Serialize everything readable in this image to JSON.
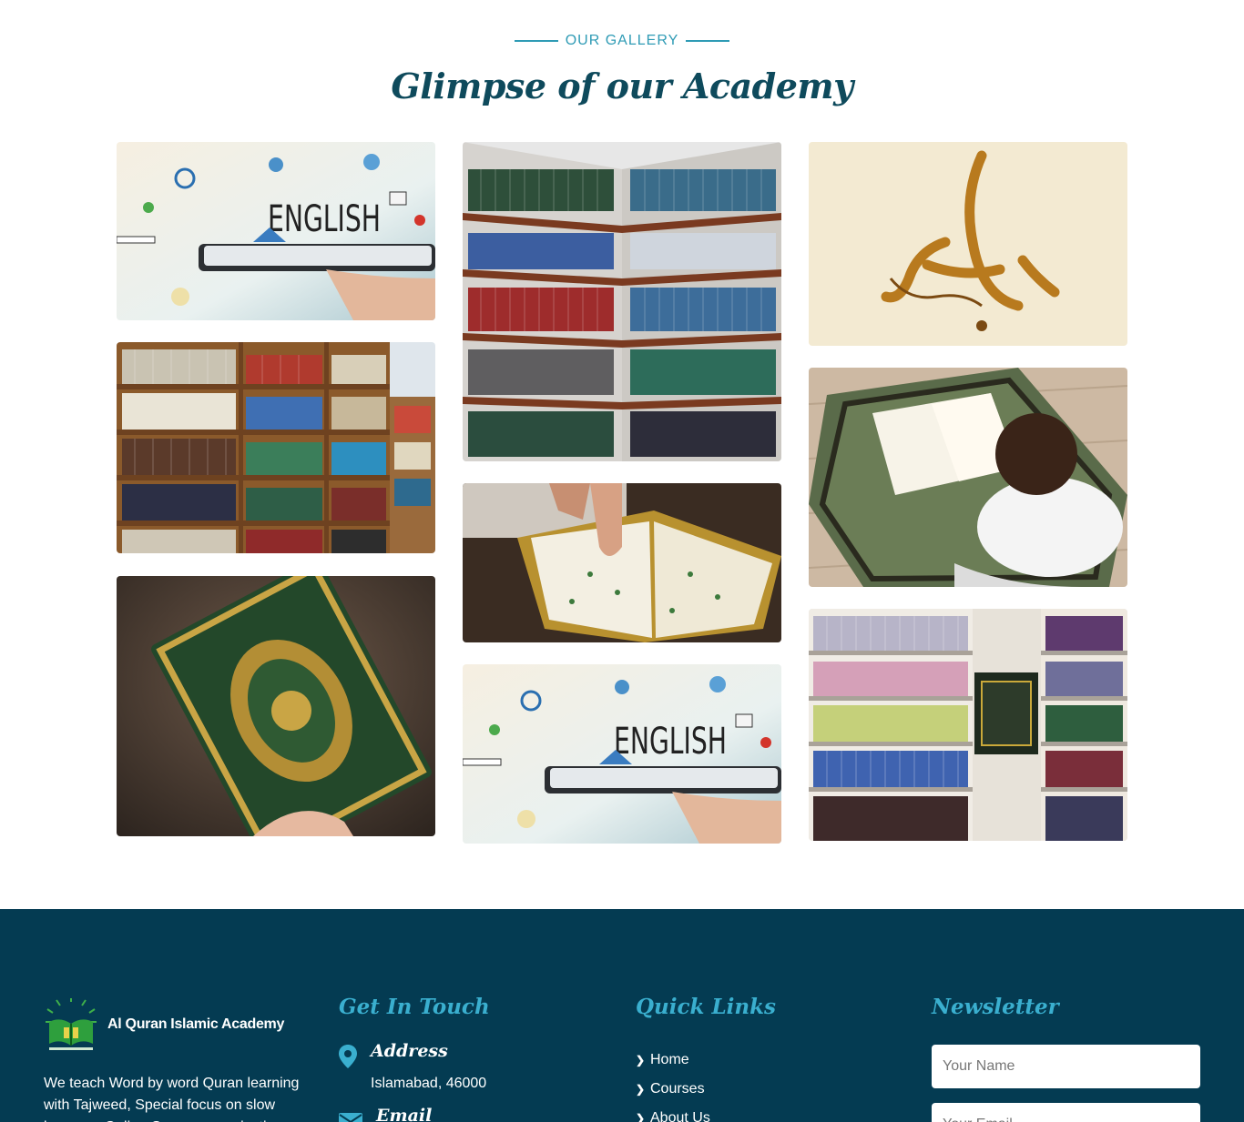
{
  "gallery": {
    "eyebrow": "OUR GALLERY",
    "title": "Glimpse of our Academy",
    "images": [
      {
        "name": "english-learning-tablet-image",
        "caption": "ENGLISH"
      },
      {
        "name": "library-corner-bookshelves-image"
      },
      {
        "name": "alhamdulillah-calligraphy-image"
      },
      {
        "name": "library-wooden-bookshelves-image"
      },
      {
        "name": "quran-reading-hand-image"
      },
      {
        "name": "boy-reading-quran-on-prayer-mat-image"
      },
      {
        "name": "green-gold-quran-cover-image"
      },
      {
        "name": "english-learning-tablet-image-2",
        "caption": "ENGLISH"
      },
      {
        "name": "library-shelves-with-posters-image"
      }
    ]
  },
  "footer": {
    "brand": {
      "name": "Al Quran Islamic Academy",
      "logo_icon": "open-book-logo-icon"
    },
    "about": "We teach Word by word Quran learning with Tajweed, Special focus on slow learners, Online Quran memorization",
    "get_in_touch": {
      "title": "Get In Touch",
      "address_label": "Address",
      "address_value": "Islamabad, 46000",
      "email_label": "Email"
    },
    "quick_links": {
      "title": "Quick Links",
      "items": [
        "Home",
        "Courses",
        "About Us"
      ]
    },
    "newsletter": {
      "title": "Newsletter",
      "name_placeholder": "Your Name",
      "email_placeholder": "Your Email"
    }
  },
  "colors": {
    "accent": "#2f9bb5",
    "footer_bg": "#043b52",
    "heading": "#0e4a5c"
  }
}
